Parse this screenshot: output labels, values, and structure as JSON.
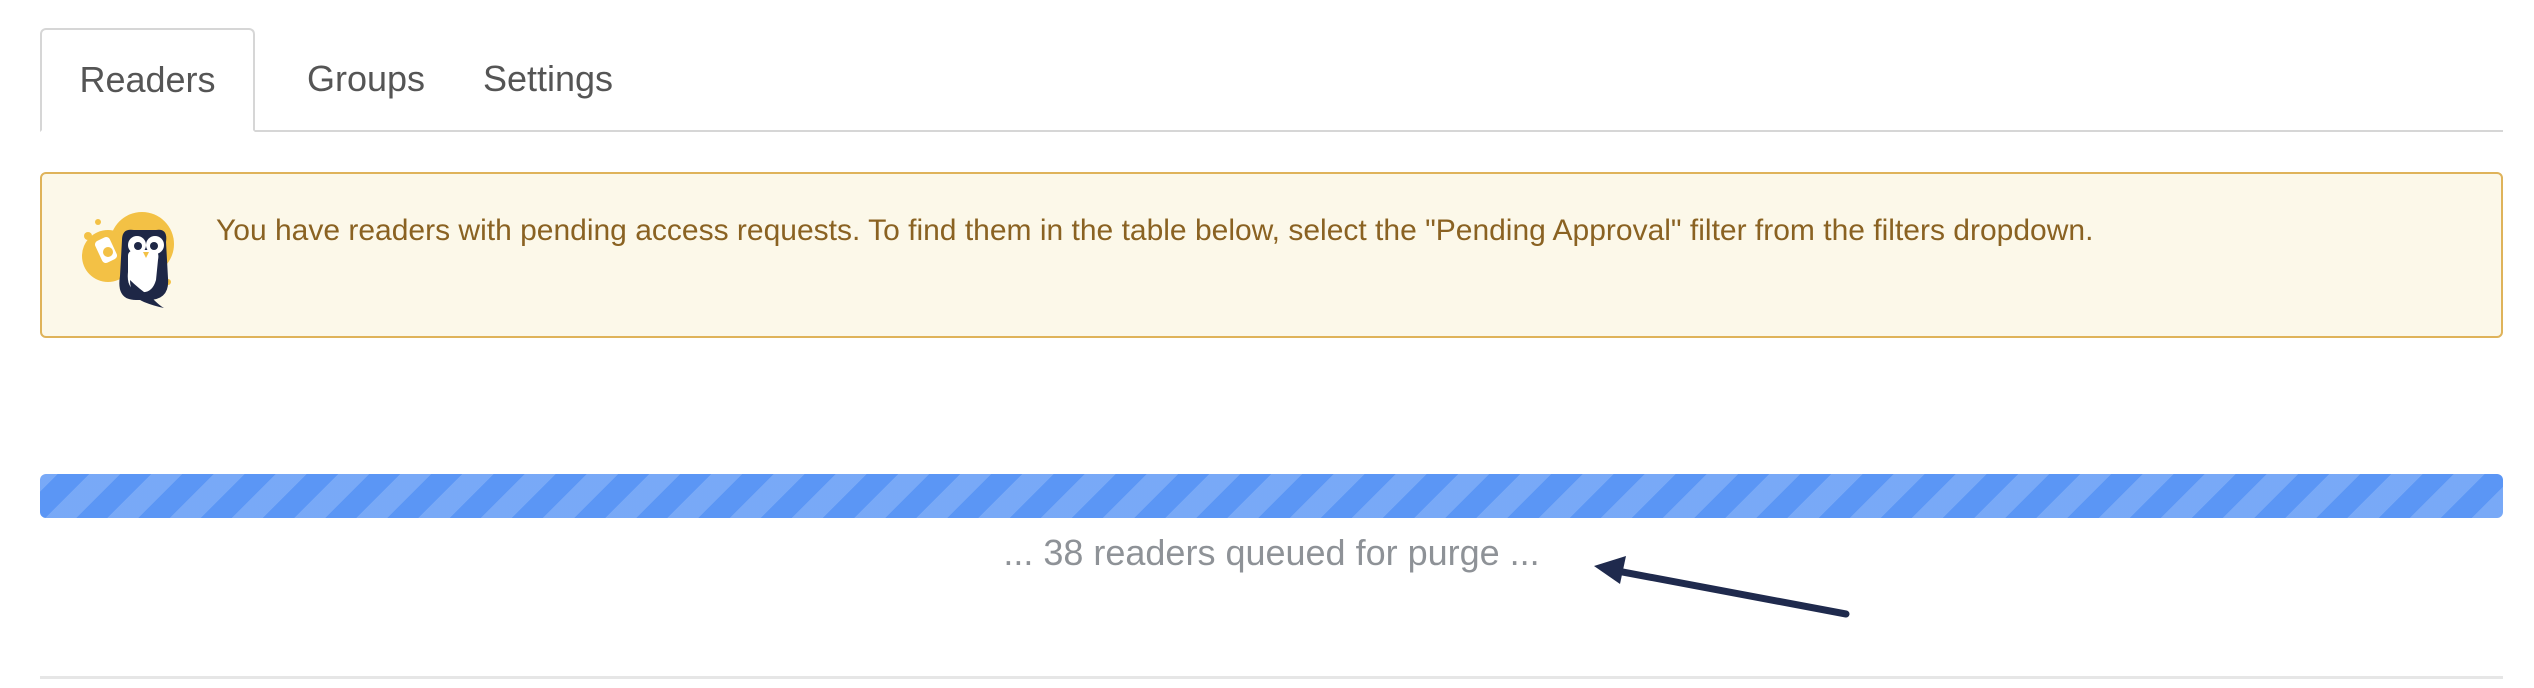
{
  "tabs": [
    {
      "label": "Readers",
      "active": true
    },
    {
      "label": "Groups",
      "active": false
    },
    {
      "label": "Settings",
      "active": false
    }
  ],
  "alert": {
    "icon": "owl-mascot-icon",
    "message": "You have readers with pending access requests. To find them in the table below, select the \"Pending Approval\" filter from the filters dropdown."
  },
  "progress": {
    "value": 1.0,
    "color": "#5b96f5",
    "status_text": "... 38 readers queued for purge ..."
  },
  "annotation": {
    "icon": "arrow-icon",
    "color": "#1f2a4d"
  },
  "colors": {
    "alert_background": "#fcf8e9",
    "alert_border": "#dfb35a",
    "alert_text": "#8a6222",
    "mascot_yellow": "#f3c145"
  }
}
